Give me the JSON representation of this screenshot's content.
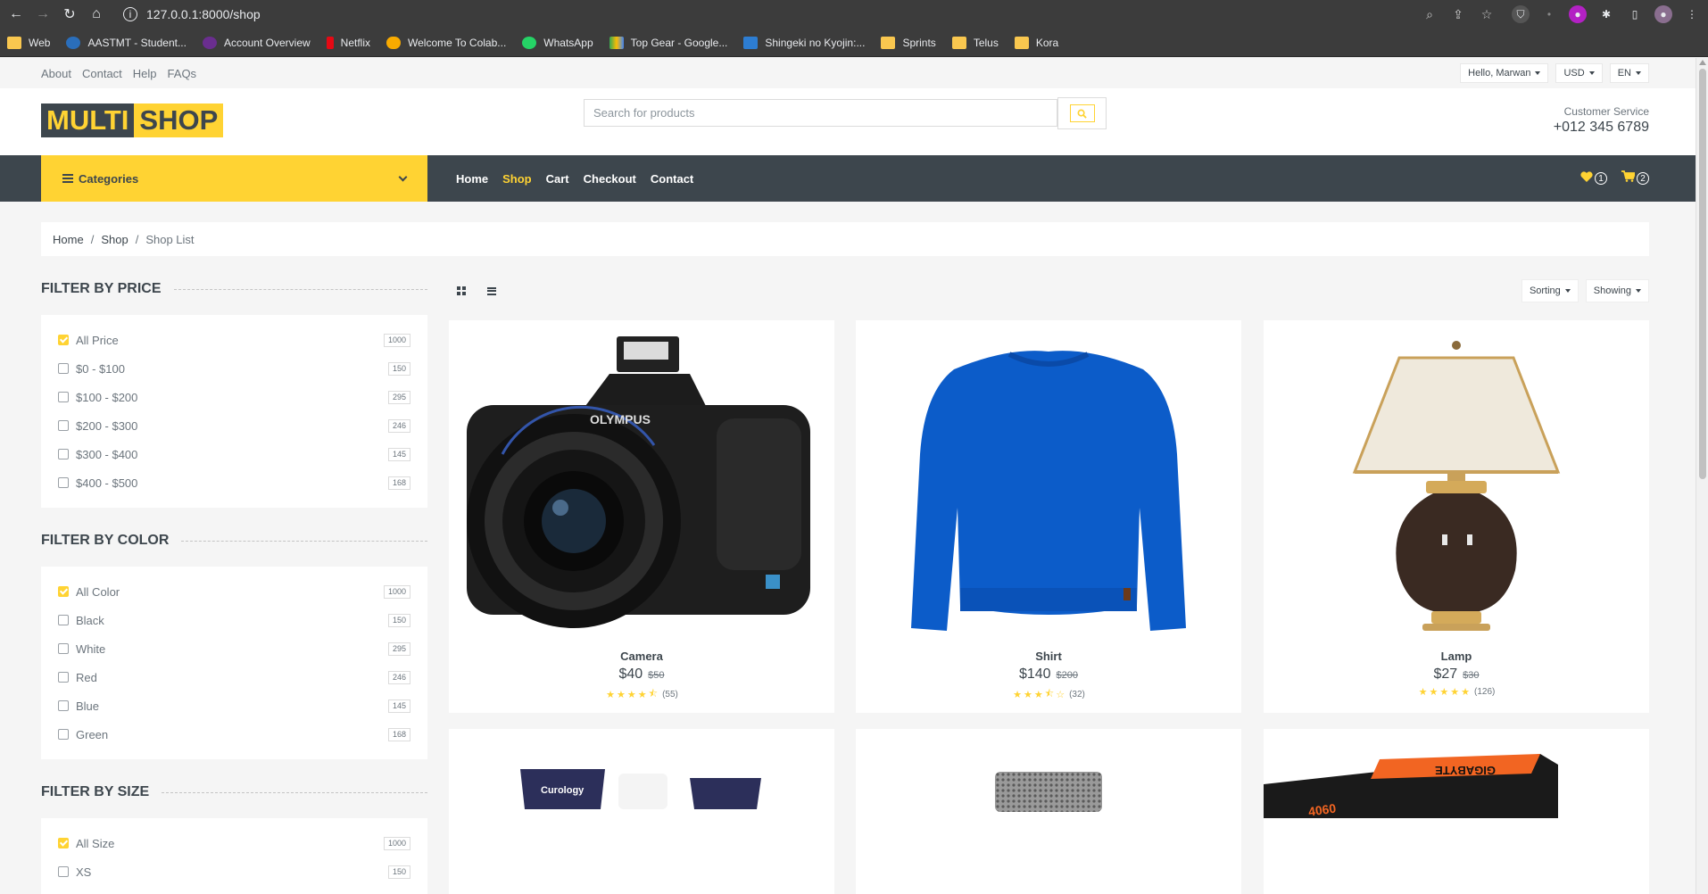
{
  "browser": {
    "url": "127.0.0.1:8000/shop",
    "bookmarks": [
      "Web",
      "AASTMT - Student...",
      "Account Overview",
      "Netflix",
      "Welcome To Colab...",
      "WhatsApp",
      "Top Gear - Google...",
      "Shingeki no Kyojin:...",
      "Sprints",
      "Telus",
      "Kora"
    ]
  },
  "topbar": {
    "links": [
      "About",
      "Contact",
      "Help",
      "FAQs"
    ],
    "user": "Hello, Marwan",
    "currency": "USD",
    "language": "EN"
  },
  "header": {
    "logo_part1": "MULTI",
    "logo_part2": "SHOP",
    "search_placeholder": "Search for products",
    "cs_label": "Customer Service",
    "cs_phone": "+012 345 6789"
  },
  "navbar": {
    "categories_label": "Categories",
    "menu": [
      "Home",
      "Shop",
      "Cart",
      "Checkout",
      "Contact"
    ],
    "wishlist_count": "1",
    "cart_count": "2"
  },
  "breadcrumb": {
    "home": "Home",
    "shop": "Shop",
    "current": "Shop List"
  },
  "filters": {
    "price": {
      "title": "Filter by price",
      "items": [
        {
          "label": "All Price",
          "count": "1000",
          "checked": true
        },
        {
          "label": "$0 - $100",
          "count": "150",
          "checked": false
        },
        {
          "label": "$100 - $200",
          "count": "295",
          "checked": false
        },
        {
          "label": "$200 - $300",
          "count": "246",
          "checked": false
        },
        {
          "label": "$300 - $400",
          "count": "145",
          "checked": false
        },
        {
          "label": "$400 - $500",
          "count": "168",
          "checked": false
        }
      ]
    },
    "color": {
      "title": "Filter by color",
      "items": [
        {
          "label": "All Color",
          "count": "1000",
          "checked": true
        },
        {
          "label": "Black",
          "count": "150",
          "checked": false
        },
        {
          "label": "White",
          "count": "295",
          "checked": false
        },
        {
          "label": "Red",
          "count": "246",
          "checked": false
        },
        {
          "label": "Blue",
          "count": "145",
          "checked": false
        },
        {
          "label": "Green",
          "count": "168",
          "checked": false
        }
      ]
    },
    "size": {
      "title": "Filter by size",
      "items": [
        {
          "label": "All Size",
          "count": "1000",
          "checked": true
        },
        {
          "label": "XS",
          "count": "150",
          "checked": false
        }
      ]
    }
  },
  "toolbar": {
    "sorting": "Sorting",
    "showing": "Showing"
  },
  "products": [
    {
      "name": "Camera",
      "price": "$40",
      "old_price": "$50",
      "rating": 4.5,
      "reviews": "(55)"
    },
    {
      "name": "Shirt",
      "price": "$140",
      "old_price": "$200",
      "rating": 3.5,
      "reviews": "(32)"
    },
    {
      "name": "Lamp",
      "price": "$27",
      "old_price": "$30",
      "rating": 5,
      "reviews": "(126)"
    }
  ],
  "colors": {
    "accent": "#ffd333",
    "dark": "#3d464d"
  }
}
